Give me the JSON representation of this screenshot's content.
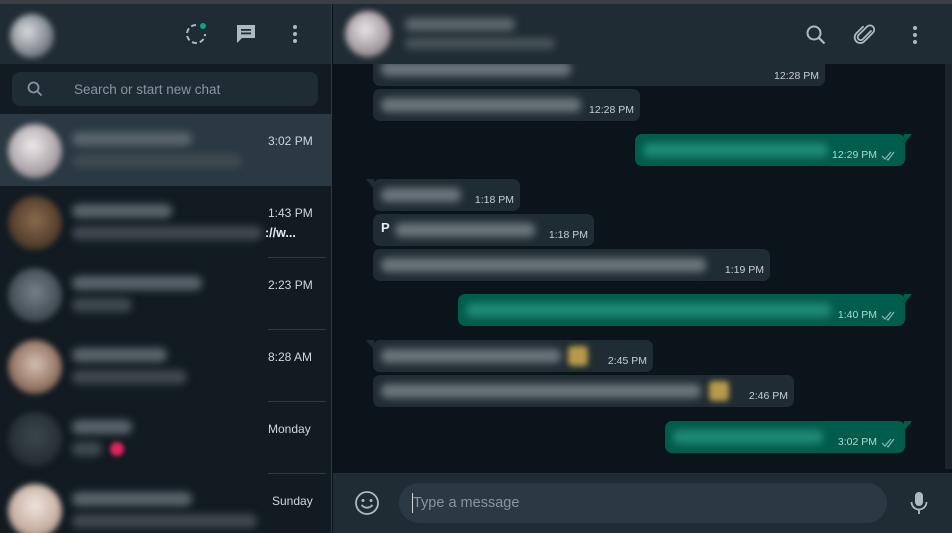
{
  "sidebar": {
    "search": {
      "placeholder": "Search or start new chat"
    },
    "icons": [
      "status-icon",
      "new-chat-icon",
      "menu-icon"
    ],
    "chats": [
      {
        "time": "3:02 PM",
        "snippet": "",
        "active": true
      },
      {
        "time": "1:43 PM",
        "snippet": "://w..."
      },
      {
        "time": "2:23 PM",
        "snippet": ""
      },
      {
        "time": "8:28 AM",
        "snippet": ""
      },
      {
        "time": "Monday",
        "snippet": ""
      },
      {
        "time": "Sunday",
        "snippet": ""
      }
    ]
  },
  "conversation": {
    "icons": [
      "search-icon",
      "attach-icon",
      "menu-icon"
    ],
    "messages": [
      {
        "dir": "in",
        "time": "12:28 PM"
      },
      {
        "dir": "in",
        "time": "12:28 PM"
      },
      {
        "dir": "out",
        "time": "12:29 PM",
        "read": true
      },
      {
        "dir": "in",
        "time": "1:18 PM"
      },
      {
        "dir": "in",
        "time": "1:18 PM",
        "visible_text": "P"
      },
      {
        "dir": "in",
        "time": "1:19 PM"
      },
      {
        "dir": "out",
        "time": "1:40 PM",
        "read": true
      },
      {
        "dir": "in",
        "time": "2:45 PM"
      },
      {
        "dir": "in",
        "time": "2:46 PM"
      },
      {
        "dir": "out",
        "time": "3:02 PM",
        "read": true
      }
    ],
    "composer": {
      "placeholder": "Type a message"
    }
  },
  "colors": {
    "panel": "#202c33",
    "background": "#0b141a",
    "incoming_bubble": "#202c33",
    "outgoing_bubble": "#005c4b",
    "accent": "#00a884"
  }
}
